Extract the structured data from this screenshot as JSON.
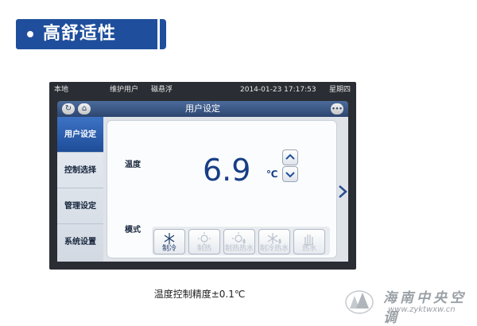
{
  "heading": {
    "title": "高舒适性"
  },
  "status": {
    "location": "本地",
    "user": "维护用户",
    "mode": "磁悬浮",
    "datetime": "2014-01-23 17:17:53",
    "weekday": "星期四"
  },
  "topbar": {
    "title": "用户设定",
    "more": "•••"
  },
  "sidebar": {
    "items": [
      {
        "label": "用户设定",
        "active": true
      },
      {
        "label": "控制选择",
        "active": false
      },
      {
        "label": "管理设定",
        "active": false
      },
      {
        "label": "系统设置",
        "active": false
      }
    ]
  },
  "panel": {
    "temp_label": "温度",
    "temp_value": "6.9",
    "temp_unit": "℃",
    "mode_label": "模式",
    "modes": [
      {
        "label": "制冷",
        "icon": "snowflake-icon",
        "enabled": true
      },
      {
        "label": "制热",
        "icon": "sun-icon",
        "enabled": false
      },
      {
        "label": "制热热水",
        "icon": "sun-drop-icon",
        "enabled": false
      },
      {
        "label": "制冷热水",
        "icon": "snowflake-drop-icon",
        "enabled": false
      },
      {
        "label": "热水",
        "icon": "hand-icon",
        "enabled": false
      }
    ]
  },
  "caption": "温度控制精度±0.1℃",
  "watermark": {
    "name": "海南中央空调",
    "url": "www.zyktwxw.cn"
  },
  "colors": {
    "accent": "#1f4f9c",
    "temp": "#173e86",
    "active_tab": "#2f63b6"
  }
}
